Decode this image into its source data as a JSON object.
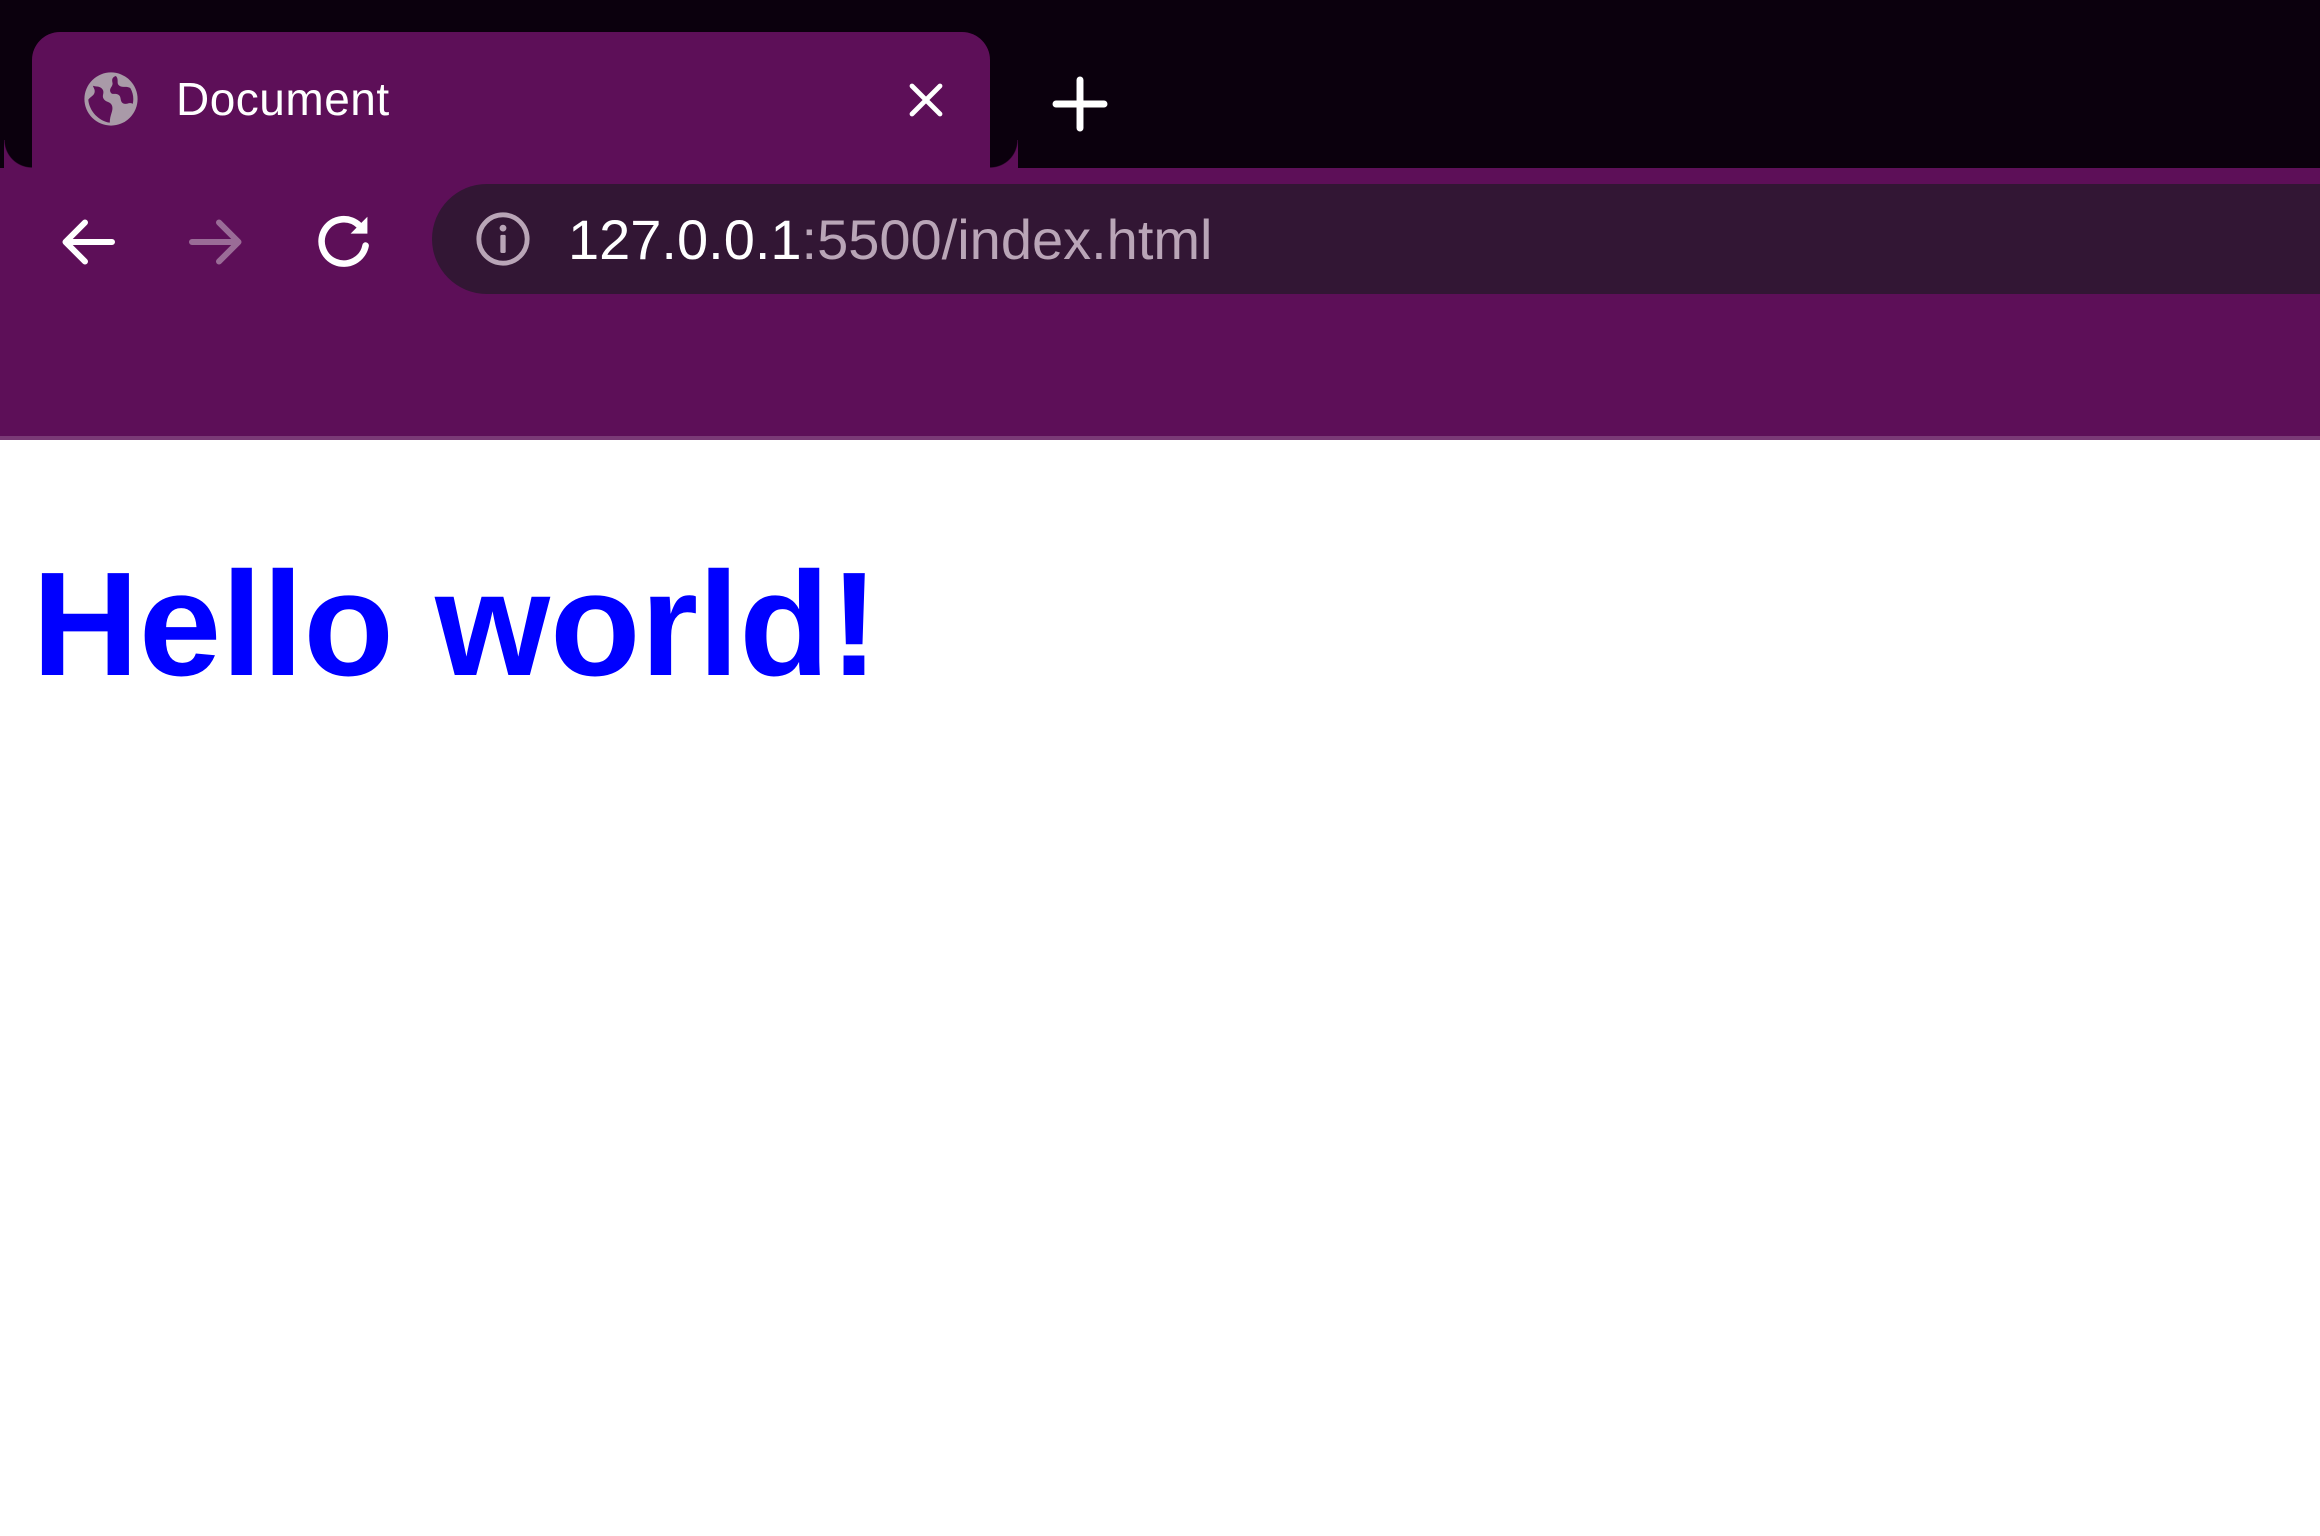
{
  "browser": {
    "tab": {
      "title": "Document",
      "favicon": "globe-icon",
      "close_icon": "close-icon"
    },
    "new_tab_icon": "plus-icon",
    "toolbar": {
      "back_icon": "arrow-left-icon",
      "forward_icon": "arrow-right-icon",
      "forward_enabled": false,
      "reload_icon": "reload-icon"
    },
    "address_bar": {
      "info_icon": "info-icon",
      "url_host": "127.0.0.1",
      "url_rest": ":5500/index.html"
    },
    "colors": {
      "tabstrip_bg": "#0b000d",
      "toolbar_bg": "#5d0f58",
      "omnibox_bg": "#321634",
      "url_dim": "#b9a5b7"
    }
  },
  "page": {
    "heading": "Hello world!",
    "heading_color": "#0000ff",
    "background": "#ffffff"
  }
}
